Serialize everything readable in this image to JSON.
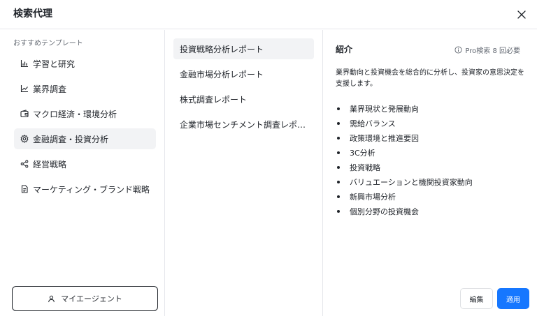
{
  "dialog": {
    "title": "検索代理"
  },
  "categories": {
    "section_label": "おすすめテンプレート",
    "items": [
      {
        "label": "学習と研究",
        "icon": "bar-chart-icon"
      },
      {
        "label": "業界調査",
        "icon": "line-chart-icon"
      },
      {
        "label": "マクロ経済・環境分析",
        "icon": "wallet-icon"
      },
      {
        "label": "金融調査・投資分析",
        "icon": "gear-icon",
        "active": true
      },
      {
        "label": "経営戦略",
        "icon": "share-nodes-icon"
      },
      {
        "label": "マーケティング・ブランド戦略",
        "icon": "document-icon"
      }
    ]
  },
  "agent_button": {
    "label": "マイエージェント",
    "icon": "user-icon"
  },
  "templates": {
    "items": [
      {
        "label": "投資戦略分析レポート",
        "active": true
      },
      {
        "label": "金融市場分析レポート"
      },
      {
        "label": "株式調査レポート"
      },
      {
        "label": "企業市場センチメント調査レポ…"
      }
    ]
  },
  "detail": {
    "title": "紹介",
    "quota": "Pro検索 8 回必要",
    "description": "業界動向と投資機会を総合的に分析し、投資家の意思決定を支援します。",
    "bullets": [
      "業界現状と発展動向",
      "需給バランス",
      "政策環境と推進要因",
      "3C分析",
      "投資戦略",
      "バリュエーションと機関投資家動向",
      "新興市場分析",
      "個別分野の投資機会"
    ]
  },
  "actions": {
    "edit_label": "編集",
    "apply_label": "適用"
  },
  "colors": {
    "accent": "#1677ff",
    "active_bg": "#f2f3f5",
    "border": "#e5e6eb"
  }
}
